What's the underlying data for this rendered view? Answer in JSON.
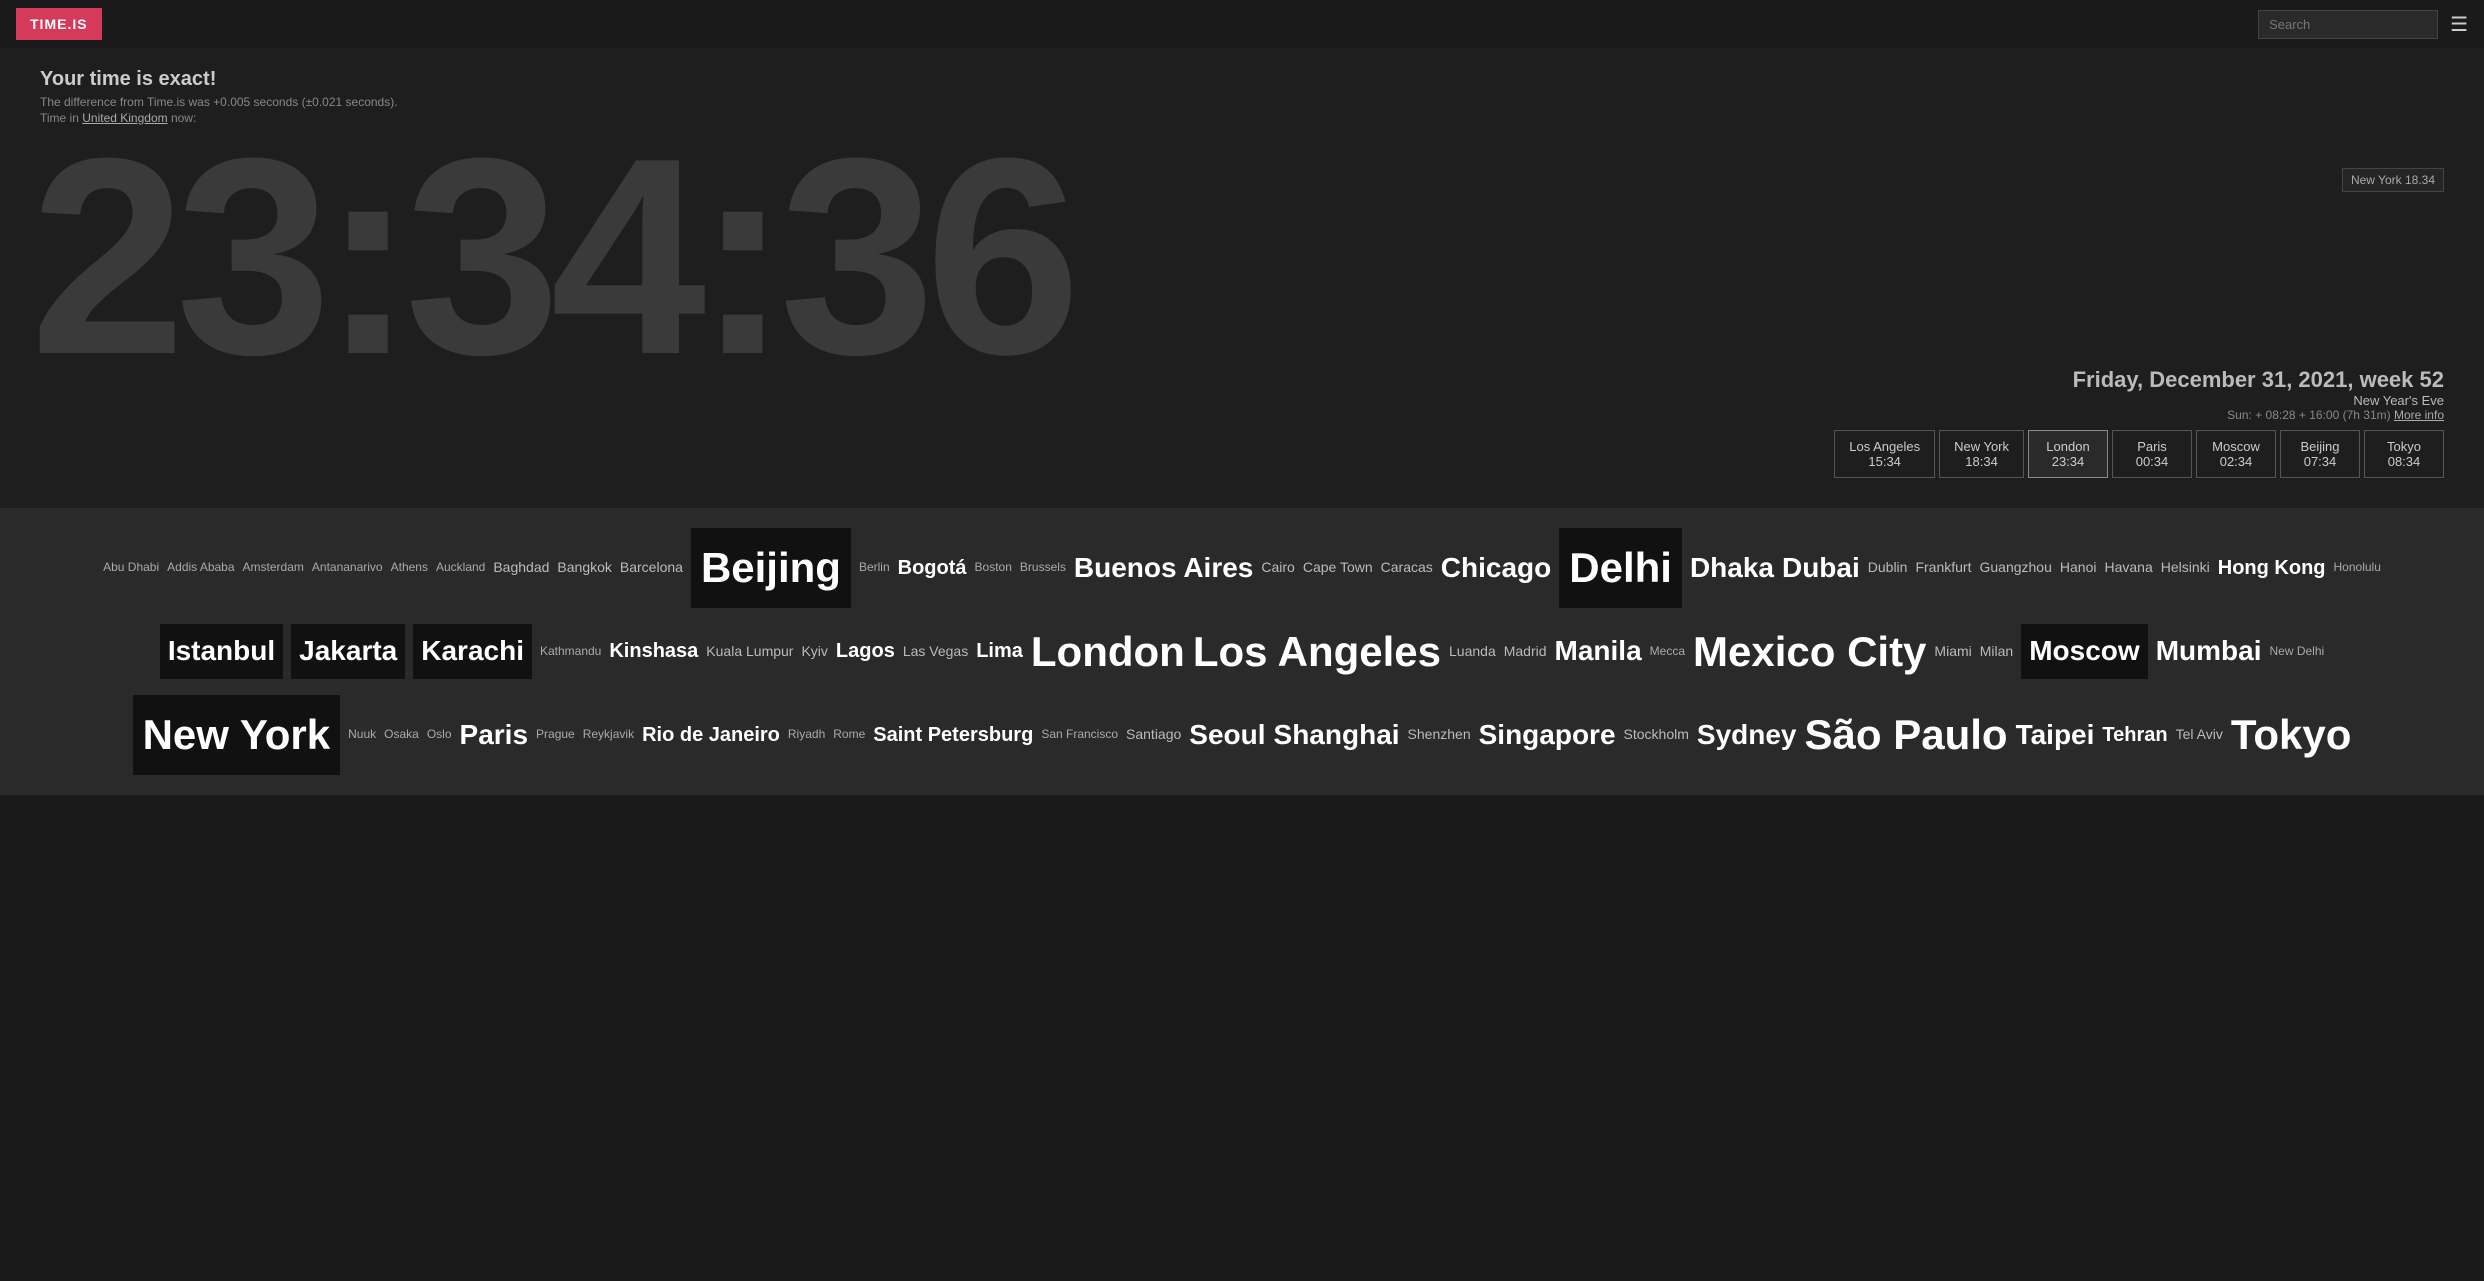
{
  "header": {
    "logo": "TIME.IS",
    "search_placeholder": "Search",
    "menu_label": "☰"
  },
  "accuracy": {
    "title": "Your time is exact!",
    "detail": "The difference from Time.is was +0.005 seconds (±0.021 seconds).",
    "uk_prefix": "Time in ",
    "uk_link": "United Kingdom",
    "uk_suffix": " now:"
  },
  "clock": {
    "display": "23:34:36"
  },
  "date": {
    "main": "Friday, December 31, 2021, week 52",
    "holiday": "New Year's Eve",
    "sun": "Sun: + 08:28 + 16:00 (7h 31m)",
    "more_info": "More info"
  },
  "ny_badge": {
    "label": "New York 18.34"
  },
  "city_times": [
    {
      "name": "Los Angeles",
      "time": "15:34",
      "active": false
    },
    {
      "name": "New York",
      "time": "18:34",
      "active": false
    },
    {
      "name": "London",
      "time": "23:34",
      "active": true
    },
    {
      "name": "Paris",
      "time": "00:34",
      "active": false
    },
    {
      "name": "Moscow",
      "time": "02:34",
      "active": false
    },
    {
      "name": "Beijing",
      "time": "07:34",
      "active": false
    },
    {
      "name": "Tokyo",
      "time": "08:34",
      "active": false
    }
  ],
  "cities": [
    {
      "label": "Abu Dhabi",
      "size": "xs"
    },
    {
      "label": "Addis Ababa",
      "size": "xs"
    },
    {
      "label": "Amsterdam",
      "size": "xs"
    },
    {
      "label": "Antananarivo",
      "size": "xs"
    },
    {
      "label": "Athens",
      "size": "xs"
    },
    {
      "label": "Auckland",
      "size": "xs"
    },
    {
      "label": "Baghdad",
      "size": "s"
    },
    {
      "label": "Bangkok",
      "size": "s"
    },
    {
      "label": "Barcelona",
      "size": "s"
    },
    {
      "label": "Beijing",
      "size": "xl-dark"
    },
    {
      "label": "Berlin",
      "size": "xs"
    },
    {
      "label": "Bogotá",
      "size": "m"
    },
    {
      "label": "Boston",
      "size": "xs"
    },
    {
      "label": "Brussels",
      "size": "xs"
    },
    {
      "label": "Buenos Aires",
      "size": "l"
    },
    {
      "label": "Cairo",
      "size": "s"
    },
    {
      "label": "Cape Town",
      "size": "s"
    },
    {
      "label": "Caracas",
      "size": "s"
    },
    {
      "label": "Chicago",
      "size": "l"
    },
    {
      "label": "Delhi",
      "size": "xl-dark"
    },
    {
      "label": "Dhaka",
      "size": "l"
    },
    {
      "label": "Dubai",
      "size": "l"
    },
    {
      "label": "Dublin",
      "size": "s"
    },
    {
      "label": "Frankfurt",
      "size": "s"
    },
    {
      "label": "Guangzhou",
      "size": "s"
    },
    {
      "label": "Hanoi",
      "size": "s"
    },
    {
      "label": "Havana",
      "size": "s"
    },
    {
      "label": "Helsinki",
      "size": "s"
    },
    {
      "label": "Hong Kong",
      "size": "m"
    },
    {
      "label": "Honolulu",
      "size": "xs"
    },
    {
      "label": "Istanbul",
      "size": "l-dark"
    },
    {
      "label": "Jakarta",
      "size": "l-dark"
    },
    {
      "label": "Karachi",
      "size": "l-dark"
    },
    {
      "label": "Kathmandu",
      "size": "xs"
    },
    {
      "label": "Kinshasa",
      "size": "m"
    },
    {
      "label": "Kuala Lumpur",
      "size": "s"
    },
    {
      "label": "Kyiv",
      "size": "s"
    },
    {
      "label": "Lagos",
      "size": "m"
    },
    {
      "label": "Las Vegas",
      "size": "s"
    },
    {
      "label": "Lima",
      "size": "m"
    },
    {
      "label": "London",
      "size": "xl"
    },
    {
      "label": "Los Angeles",
      "size": "xl"
    },
    {
      "label": "Luanda",
      "size": "s"
    },
    {
      "label": "Madrid",
      "size": "s"
    },
    {
      "label": "Manila",
      "size": "l"
    },
    {
      "label": "Mecca",
      "size": "xs"
    },
    {
      "label": "Mexico City",
      "size": "xl"
    },
    {
      "label": "Miami",
      "size": "s"
    },
    {
      "label": "Milan",
      "size": "s"
    },
    {
      "label": "Moscow",
      "size": "l-dark"
    },
    {
      "label": "Mumbai",
      "size": "l"
    },
    {
      "label": "New Delhi",
      "size": "xs"
    },
    {
      "label": "New York",
      "size": "xl-dark"
    },
    {
      "label": "Nuuk",
      "size": "xs"
    },
    {
      "label": "Osaka",
      "size": "xs"
    },
    {
      "label": "Oslo",
      "size": "xs"
    },
    {
      "label": "Paris",
      "size": "l"
    },
    {
      "label": "Prague",
      "size": "xs"
    },
    {
      "label": "Reykjavik",
      "size": "xs"
    },
    {
      "label": "Rio de Janeiro",
      "size": "m"
    },
    {
      "label": "Riyadh",
      "size": "xs"
    },
    {
      "label": "Rome",
      "size": "xs"
    },
    {
      "label": "Saint Petersburg",
      "size": "m"
    },
    {
      "label": "San Francisco",
      "size": "xs"
    },
    {
      "label": "Santiago",
      "size": "s"
    },
    {
      "label": "Seoul",
      "size": "l"
    },
    {
      "label": "Shanghai",
      "size": "l"
    },
    {
      "label": "Shenzhen",
      "size": "s"
    },
    {
      "label": "Singapore",
      "size": "l"
    },
    {
      "label": "Stockholm",
      "size": "s"
    },
    {
      "label": "Sydney",
      "size": "l"
    },
    {
      "label": "São Paulo",
      "size": "xl"
    },
    {
      "label": "Taipei",
      "size": "l"
    },
    {
      "label": "Tehran",
      "size": "m"
    },
    {
      "label": "Tel Aviv",
      "size": "s"
    },
    {
      "label": "Tokyo",
      "size": "xl"
    }
  ]
}
